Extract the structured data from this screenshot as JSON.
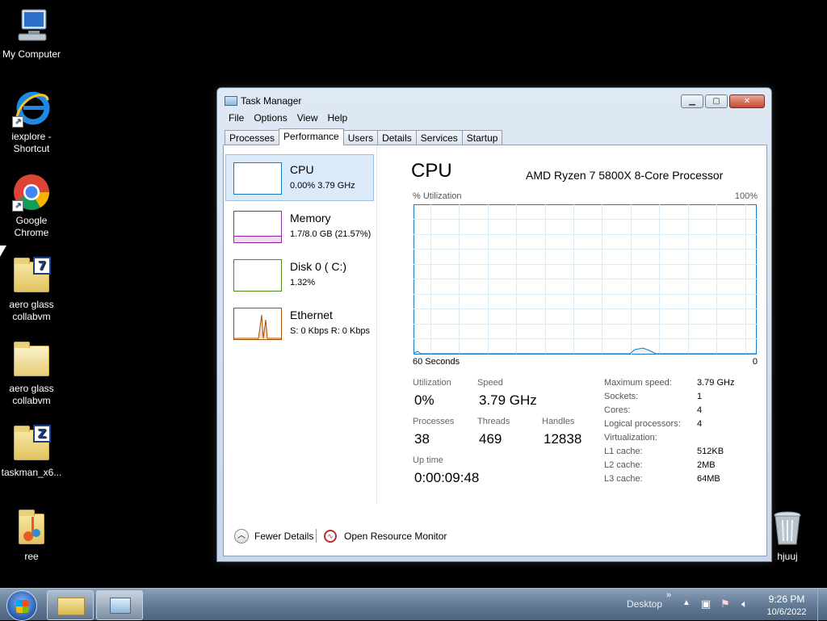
{
  "desktop": {
    "icons": [
      {
        "label1": "My Computer",
        "label2": ""
      },
      {
        "label1": "iexplore -",
        "label2": "Shortcut"
      },
      {
        "label1": "Google",
        "label2": "Chrome"
      },
      {
        "label1": "aero glass",
        "label2": "collabvm",
        "badge": "7"
      },
      {
        "label1": "aero glass",
        "label2": "collabvm"
      },
      {
        "label1": "taskman_x6...",
        "label2": "",
        "badge": "Z"
      },
      {
        "label1": "ree",
        "label2": ""
      },
      {
        "label1": "hjuuj",
        "label2": ""
      }
    ]
  },
  "window": {
    "title": "Task Manager",
    "menu": [
      "File",
      "Options",
      "View",
      "Help"
    ],
    "tabs": [
      "Processes",
      "Performance",
      "Users",
      "Details",
      "Services",
      "Startup"
    ],
    "active_tab": "Performance",
    "resources": [
      {
        "title": "CPU",
        "sub": "0.00%  3.79 GHz",
        "color": "#1a78c2"
      },
      {
        "title": "Memory",
        "sub": "1.7/8.0 GB (21.57%)",
        "color": "#8b2a9b"
      },
      {
        "title": "Disk 0 ( C:)",
        "sub": "1.32%",
        "color": "#4d8a16"
      },
      {
        "title": "Ethernet",
        "sub": "S: 0 Kbps R: 0 Kbps",
        "color": "#a74f01"
      }
    ],
    "main": {
      "title": "CPU",
      "processor": "AMD Ryzen 7 5800X 8-Core Processor",
      "graph_label_left": "% Utilization",
      "graph_label_right": "100%",
      "axis_left": "60 Seconds",
      "axis_right": "0",
      "stats": {
        "utilization_label": "Utilization",
        "utilization": "0%",
        "speed_label": "Speed",
        "speed": "3.79 GHz",
        "processes_label": "Processes",
        "processes": "38",
        "threads_label": "Threads",
        "threads": "469",
        "handles_label": "Handles",
        "handles": "12838",
        "uptime_label": "Up time",
        "uptime": "0:00:09:48"
      },
      "specs": [
        {
          "label": "Maximum speed:",
          "value": "3.79 GHz"
        },
        {
          "label": "Sockets:",
          "value": "1"
        },
        {
          "label": "Cores:",
          "value": "4"
        },
        {
          "label": "Logical processors:",
          "value": "4"
        },
        {
          "label": "Virtualization:",
          "value": ""
        },
        {
          "label": "L1 cache:",
          "value": "512KB"
        },
        {
          "label": "L2 cache:",
          "value": "2MB"
        },
        {
          "label": "L3 cache:",
          "value": "64MB"
        }
      ]
    },
    "footer": {
      "fewer_details": "Fewer Details",
      "open_monitor": "Open Resource Monitor"
    }
  },
  "taskbar": {
    "desktop_label": "Desktop",
    "time": "9:26 PM",
    "date": "10/6/2022"
  },
  "colors": {
    "cpu_line": "#1a78c2",
    "grid": "#d9ecf7"
  }
}
